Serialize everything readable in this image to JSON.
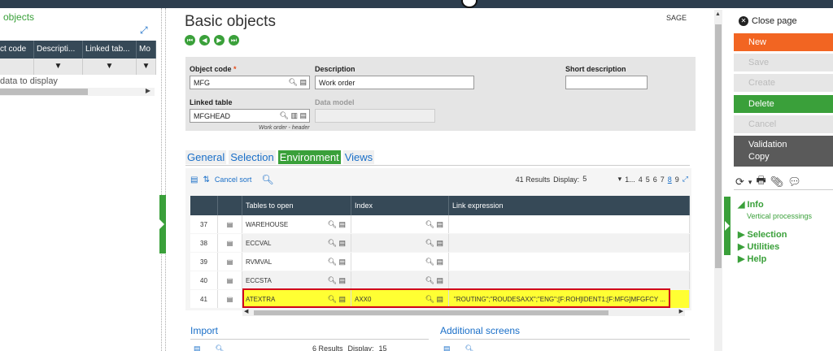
{
  "left_panel": {
    "title": "objects",
    "columns": [
      "ct code",
      "Descripti...",
      "Linked tab...",
      "Mo"
    ],
    "empty_text": "data to display"
  },
  "header": {
    "title": "Basic objects",
    "badge": "SAGE"
  },
  "form": {
    "object_code": {
      "label": "Object code",
      "value": "MFG"
    },
    "description": {
      "label": "Description",
      "value": "Work order"
    },
    "short_description": {
      "label": "Short description",
      "value": ""
    },
    "linked_table": {
      "label": "Linked table",
      "value": "MFGHEAD",
      "note": "Work order - header"
    },
    "data_model": {
      "label": "Data model",
      "value": ""
    }
  },
  "tabs": [
    {
      "label": "General"
    },
    {
      "label": "Selection"
    },
    {
      "label": "Environment"
    },
    {
      "label": "Views"
    }
  ],
  "grid": {
    "cancel_sort": "Cancel sort",
    "results": "41 Results",
    "display_label": "Display:",
    "display_value": "5",
    "pager_prefix": "1...",
    "pages": [
      "4",
      "5",
      "6",
      "7",
      "8",
      "9"
    ],
    "current_page": "8",
    "columns": [
      "Tables to open",
      "Index",
      "Link expression"
    ],
    "rows": [
      {
        "num": "37",
        "table": "WAREHOUSE",
        "index": "",
        "link": ""
      },
      {
        "num": "38",
        "table": "ECCVAL",
        "index": "",
        "link": ""
      },
      {
        "num": "39",
        "table": "RVMVAL",
        "index": "",
        "link": ""
      },
      {
        "num": "40",
        "table": "ECCSTA",
        "index": "",
        "link": ""
      },
      {
        "num": "41",
        "table": "ATEXTRA",
        "index": "AXX0",
        "link": "\"ROUTING\";\"ROUDESAXX\";\"ENG\";[F:ROH]IDENT1;[F:MFG]MFGFCY ..."
      }
    ]
  },
  "sections": {
    "import": {
      "title": "Import",
      "results": "6 Results",
      "display_label": "Display:",
      "display_value": "15"
    },
    "additional": {
      "title": "Additional screens"
    }
  },
  "right_panel": {
    "close_page": "Close page",
    "buttons": {
      "new": "New",
      "save": "Save",
      "create": "Create",
      "delete": "Delete",
      "cancel": "Cancel",
      "validation": "Validation",
      "copy": "Copy"
    },
    "info": "Info",
    "vertical": "Vertical processings",
    "selection": "Selection",
    "utilities": "Utilities",
    "help": "Help"
  }
}
